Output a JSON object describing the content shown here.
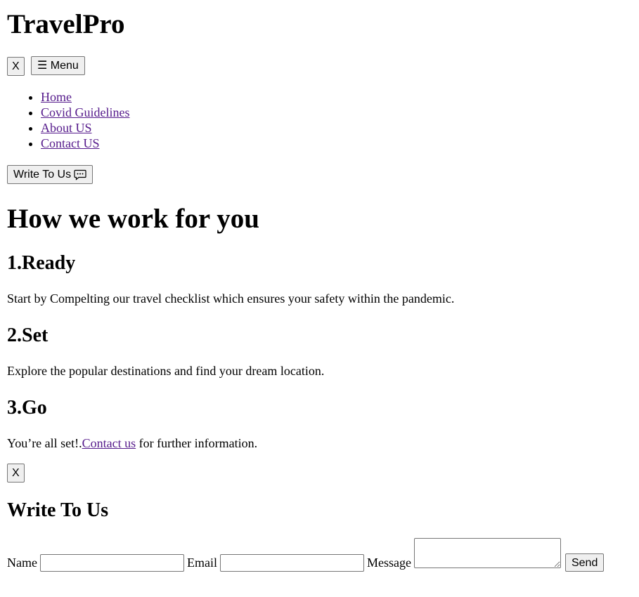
{
  "header": {
    "brand": "TravelPro",
    "close_label": "X",
    "menu_label": "☰ Menu"
  },
  "nav": {
    "items": [
      {
        "label": "Home"
      },
      {
        "label": "Covid Guidelines"
      },
      {
        "label": "About US"
      },
      {
        "label": "Contact US"
      }
    ],
    "write_button_label": "Write To Us",
    "write_button_icon": "chat-bubble-icon"
  },
  "main": {
    "title": "How we work for you",
    "steps": [
      {
        "title": "1.Ready",
        "text": "Start by Compelting our travel checklist which ensures your safety within the pandemic."
      },
      {
        "title": "2.Set",
        "text": "Explore the popular destinations and find your dream location."
      },
      {
        "title": "3.Go",
        "text_before": "You’re all set!.",
        "link_label": "Contact us",
        "text_after": " for further information."
      }
    ]
  },
  "contact_form": {
    "close_label": "X",
    "title": "Write To Us",
    "name_label": "Name",
    "name_value": "",
    "email_label": "Email",
    "email_value": "",
    "message_label": "Message",
    "message_value": "",
    "send_label": "Send"
  },
  "colors": {
    "visited_link": "#551a8b",
    "button_bg": "#efefef",
    "button_border": "#767676"
  }
}
